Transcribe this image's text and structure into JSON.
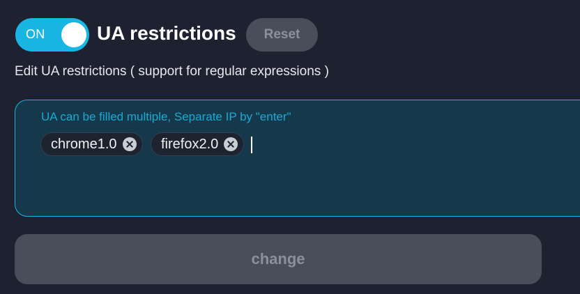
{
  "header": {
    "toggle_label": "ON",
    "toggle_state": "on",
    "title": "UA restrictions",
    "reset_label": "Reset"
  },
  "subtitle": "Edit UA restrictions ( support for regular expressions )",
  "ua_input": {
    "hint": "UA can be filled multiple, Separate IP by \"enter\"",
    "tags": [
      {
        "label": "chrome1.0"
      },
      {
        "label": "firefox2.0"
      }
    ]
  },
  "change_label": "change",
  "colors": {
    "accent": "#19b6e3",
    "background": "#1e2230",
    "disabled_button": "#4a4e5b",
    "input_background": "#15394b"
  },
  "icons": {
    "tag_remove": "circle-x-icon"
  }
}
